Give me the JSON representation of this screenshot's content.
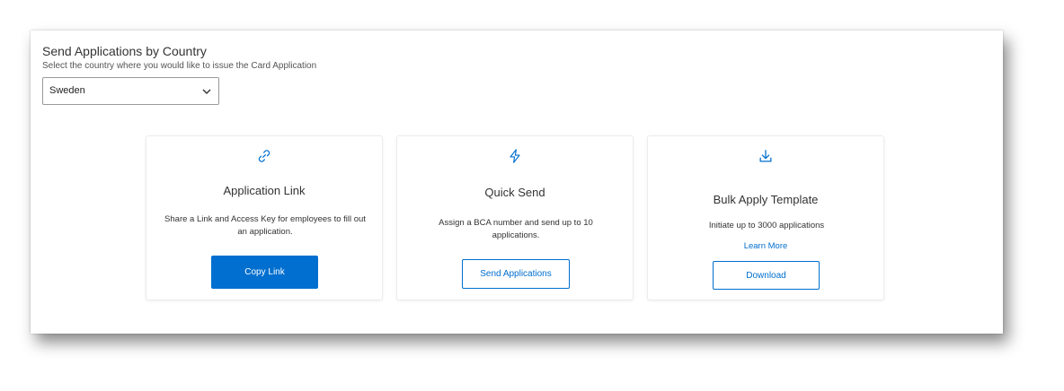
{
  "header": {
    "title": "Send Applications by Country",
    "subtitle": "Select the country where you would like to issue the Card Application"
  },
  "country_select": {
    "selected": "Sweden"
  },
  "cards": [
    {
      "icon": "link-icon",
      "title": "Application Link",
      "description": "Share a Link and Access Key for employees to fill out an application.",
      "button_label": "Copy Link"
    },
    {
      "icon": "lightning-icon",
      "title": "Quick Send",
      "description": "Assign a BCA number and send up to 10 applications.",
      "button_label": "Send Applications"
    },
    {
      "icon": "download-icon",
      "title": "Bulk Apply Template",
      "description": "Initiate up to 3000 applications",
      "link_label": "Learn More",
      "button_label": "Download"
    }
  ],
  "colors": {
    "accent": "#006fcf",
    "text": "#333333",
    "background": "#ffffff"
  }
}
